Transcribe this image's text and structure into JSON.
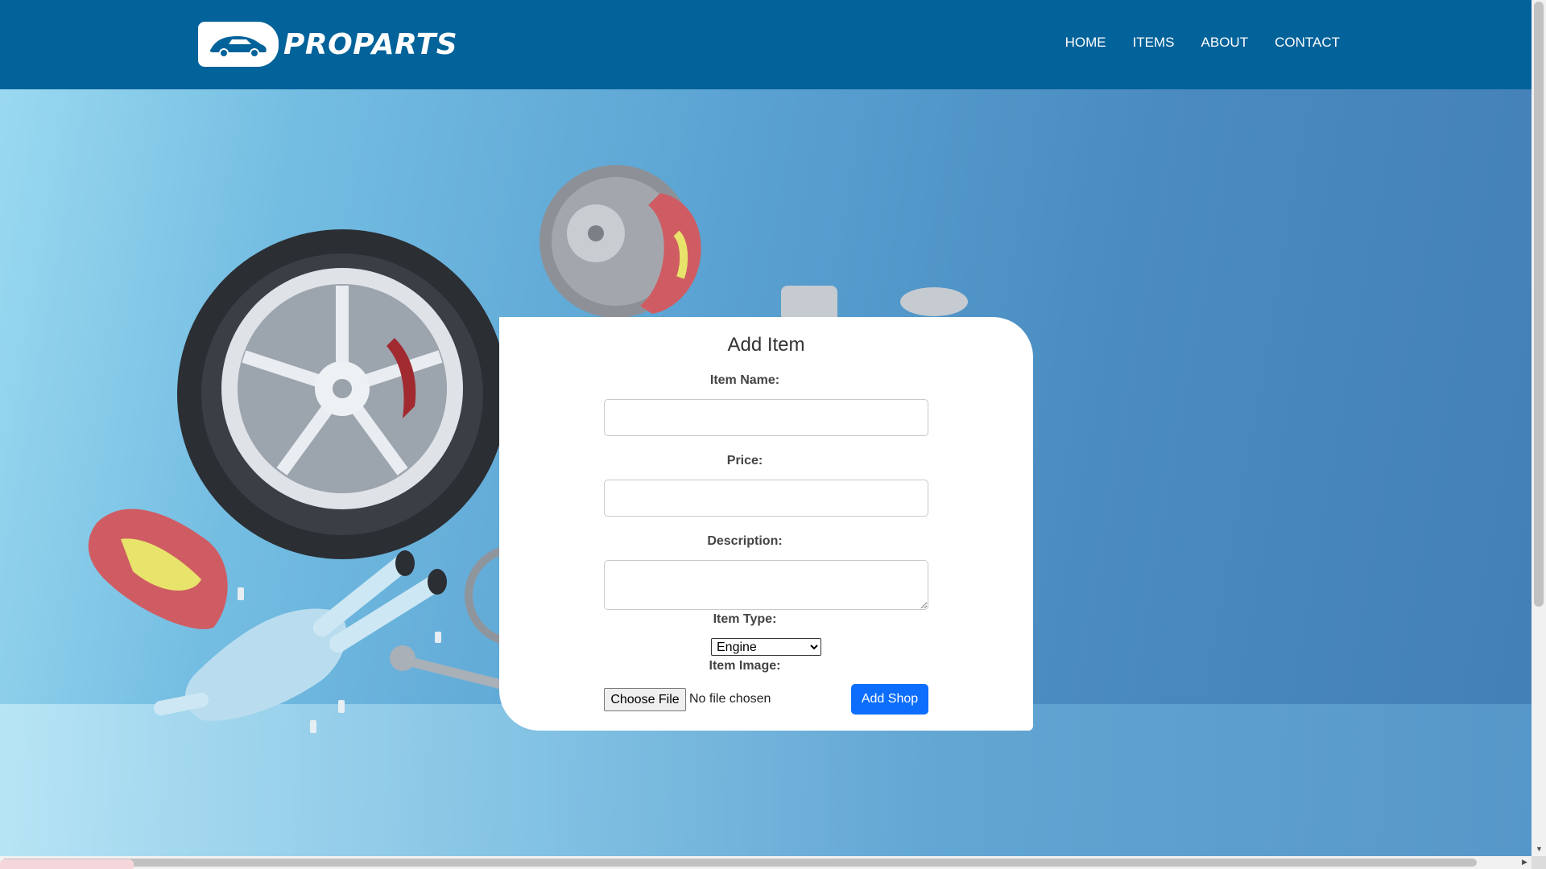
{
  "brand": {
    "logo_text": "PROPARTS"
  },
  "nav": {
    "items": [
      {
        "label": "HOME"
      },
      {
        "label": "ITEMS"
      },
      {
        "label": "ABOUT"
      },
      {
        "label": "CONTACT"
      }
    ]
  },
  "form": {
    "title": "Add Item",
    "item_name_label": "Item Name:",
    "item_name_value": "",
    "price_label": "Price:",
    "price_value": "",
    "description_label": "Description:",
    "description_value": "",
    "item_type_label": "Item Type:",
    "item_type_selected": "Engine",
    "item_image_label": "Item Image:",
    "choose_file_label": "Choose File",
    "file_status": "No file chosen",
    "submit_label": "Add Shop"
  },
  "colors": {
    "navbar": "#02629a",
    "submit_button": "#0d6efd"
  },
  "icons": {
    "logo": "car-icon",
    "select_arrow": "chevron-down-icon"
  }
}
